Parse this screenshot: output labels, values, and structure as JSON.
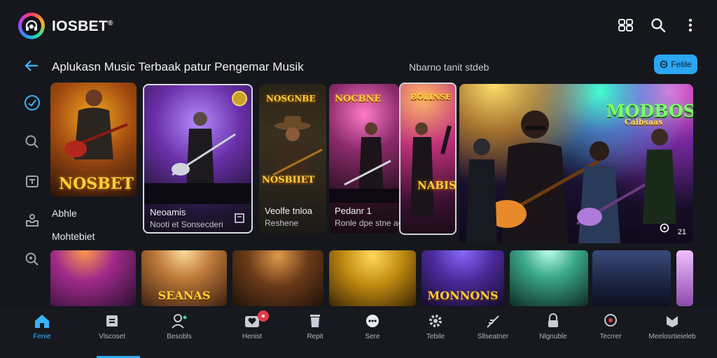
{
  "app": {
    "title": "IOSBET",
    "trademark": "®"
  },
  "header": {
    "headline": "Aplukasn Music Terbaak patur Pengemar Musik",
    "subhead": "Nbarno tanit stdeb",
    "action_button": "Fetile"
  },
  "sections": {
    "first_label": "Abhle",
    "second_label": "Mohtebiet"
  },
  "featured": [
    {
      "title": "NOSBET",
      "caption": "",
      "subcaption": ""
    },
    {
      "title": "",
      "caption": "Neoamis",
      "subcaption": "Nooti et Sonsecderi"
    },
    {
      "title": "NOSGNBE",
      "caption": "Veolfe tnloa",
      "subcaption": "Reshene",
      "art_title": "NOSBIIET"
    },
    {
      "title": "NOCBNE",
      "caption": "Pedanr 1",
      "subcaption": "Ronle dpe stne aeslo"
    },
    {
      "title": "BOLINSE",
      "art_title": "NABIS"
    },
    {
      "title": "MODBOS",
      "sub_title": "Calbsaas",
      "counter": "21"
    }
  ],
  "thumbnails": [
    "",
    "SEANAS",
    "",
    "",
    "MONNONS",
    "",
    "",
    ""
  ],
  "bottom_nav": [
    {
      "label": "Fenie",
      "icon": "home-icon",
      "active": true
    },
    {
      "label": "Vlscoset",
      "icon": "library-icon"
    },
    {
      "label": "Besobls",
      "icon": "user-icon"
    },
    {
      "label": "Henist",
      "icon": "heart-icon",
      "badge": true
    },
    {
      "label": "Repit",
      "icon": "trash-icon"
    },
    {
      "label": "Sere",
      "icon": "chat-icon"
    },
    {
      "label": "Tebile",
      "icon": "gear-icon"
    },
    {
      "label": "Sllseatner",
      "icon": "feather-icon"
    },
    {
      "label": "Nlgnuble",
      "icon": "lock-icon"
    },
    {
      "label": "Tecrrer",
      "icon": "location-icon"
    },
    {
      "label": "Meelosrtieieleb",
      "icon": "shield-icon"
    }
  ],
  "colors": {
    "accent": "#2aa6f2",
    "background": "#15171c",
    "gold": "#ffcf3a",
    "badge": "#e53b4a"
  }
}
